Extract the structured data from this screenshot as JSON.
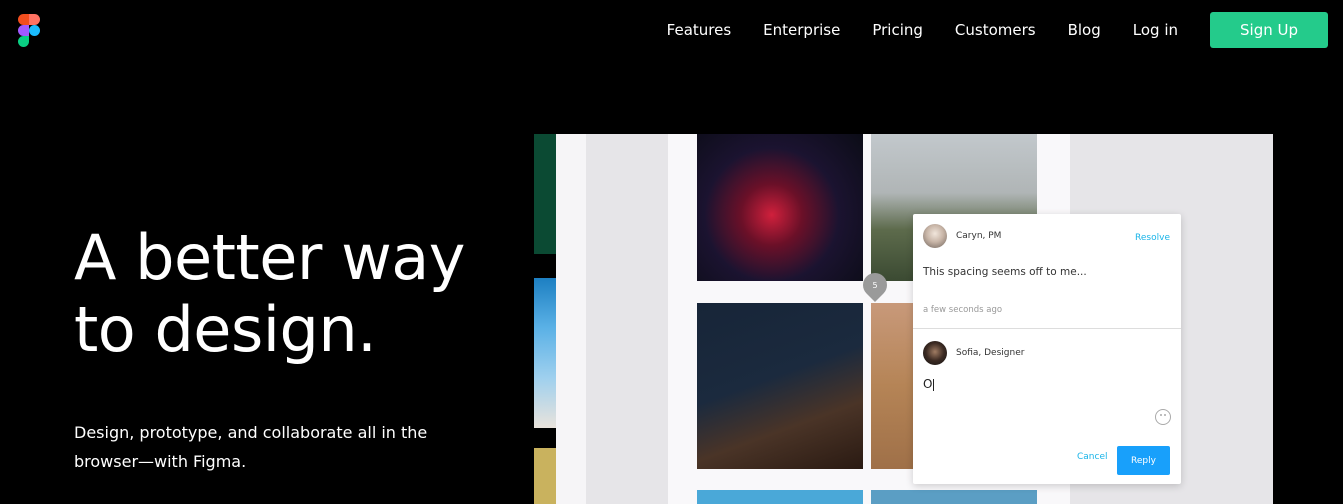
{
  "brand": {
    "logo": "figma-logo",
    "colors": [
      "#f24e1e",
      "#ff7262",
      "#a259ff",
      "#1abcfe",
      "#0acf83"
    ]
  },
  "nav": {
    "items": [
      "Features",
      "Enterprise",
      "Pricing",
      "Customers",
      "Blog",
      "Log in"
    ],
    "signup_label": "Sign Up",
    "signup_color": "#24cb8b"
  },
  "hero": {
    "title_line1": "A better way",
    "title_line2": "to design.",
    "subtitle": "Design, prototype, and collaborate all in the browser—with Figma."
  },
  "comment": {
    "author1": "Caryn, PM",
    "resolve_label": "Resolve",
    "message": "This spacing seems off to me...",
    "time": "a few seconds ago",
    "author2": "Sofia, Designer",
    "typed": "O",
    "cancel_label": "Cancel",
    "reply_label": "Reply",
    "pin_number": "5",
    "accent": "#18a0fb"
  }
}
